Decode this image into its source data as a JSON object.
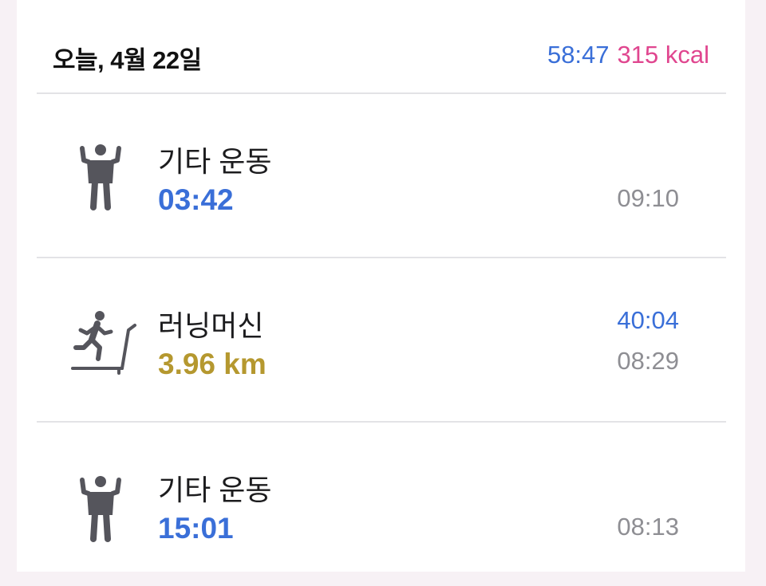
{
  "header": {
    "date": "오늘, 4월 22일",
    "total_duration": "58:47",
    "total_calories": "315 kcal"
  },
  "workouts": [
    {
      "icon": "strength-figure-icon",
      "title": "기타 운동",
      "metric": "03:42",
      "duration": "",
      "time": "09:10"
    },
    {
      "icon": "treadmill-runner-icon",
      "title": "러닝머신",
      "metric": "3.96 km",
      "duration": "40:04",
      "time": "08:29"
    },
    {
      "icon": "strength-figure-icon",
      "title": "기타 운동",
      "metric": "15:01",
      "duration": "",
      "time": "08:13"
    }
  ],
  "colors": {
    "duration_blue": "#3a6fd8",
    "calories_pink": "#e0468f",
    "distance_gold": "#b5982f",
    "secondary_gray": "#8e8e93",
    "icon_gray": "#55555c"
  }
}
